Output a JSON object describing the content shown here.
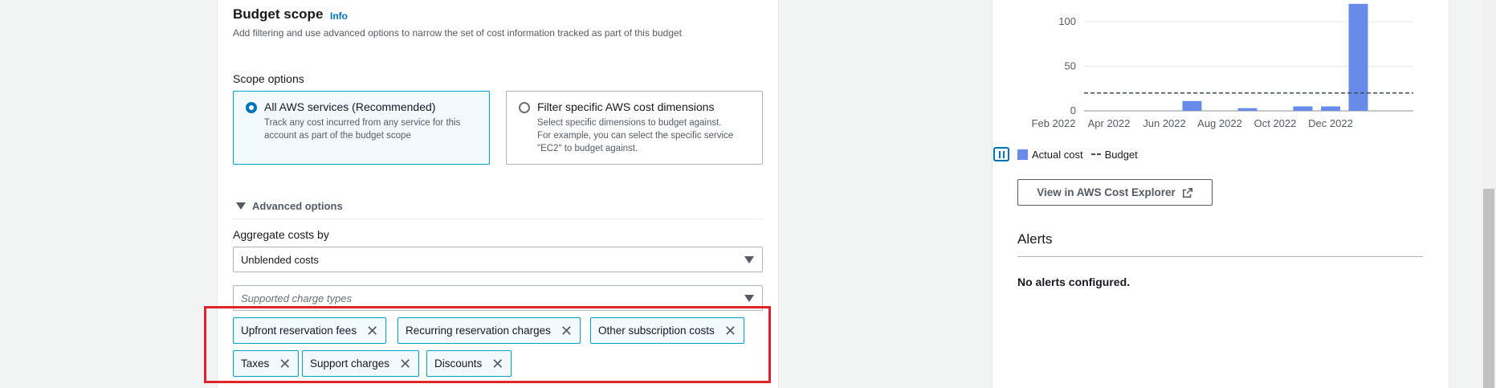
{
  "budget_scope": {
    "title": "Budget scope",
    "info_link": "Info",
    "description": "Add filtering and use advanced options to narrow the set of cost information tracked as part of this budget",
    "scope_options_label": "Scope options",
    "options": [
      {
        "title": "All AWS services (Recommended)",
        "description": "Track any cost incurred from any service for this\naccount as part of the budget scope",
        "selected": true
      },
      {
        "title": "Filter specific AWS cost dimensions",
        "description": "Select specific dimensions to budget against.\nFor example, you can select the specific service\n\"EC2\" to budget against.",
        "selected": false
      }
    ],
    "advanced_options_label": "Advanced options",
    "aggregate_label": "Aggregate costs by",
    "aggregate_value": "Unblended costs",
    "charge_types_placeholder": "Supported charge types",
    "tokens": [
      "Upfront reservation fees",
      "Recurring reservation charges",
      "Other subscription costs",
      "Taxes",
      "Support charges",
      "Discounts"
    ]
  },
  "chart_data": {
    "type": "bar",
    "y_ticks": [
      "100",
      "50",
      "0"
    ],
    "x_tick_labels": [
      "Feb 2022",
      "Apr 2022",
      "Jun 2022",
      "Aug 2022",
      "Oct 2022",
      "Dec 2022"
    ],
    "series": [
      {
        "name": "Actual cost",
        "x": [
          "Jul 2022",
          "Sep 2022",
          "Nov 2022",
          "Dec 2022",
          "Jan 2023"
        ],
        "values": [
          11,
          3,
          5,
          5,
          120
        ]
      },
      {
        "name": "Budget",
        "style": "dashed",
        "value": 20
      }
    ],
    "ylim": [
      0,
      100
    ],
    "colors": {
      "actual": "#688ae8",
      "budget": "#414d5c"
    }
  },
  "legend": {
    "actual_label": "Actual cost",
    "budget_label": "Budget"
  },
  "view_button": {
    "label": "View in AWS Cost Explorer"
  },
  "alerts": {
    "title": "Alerts",
    "empty_text": "No alerts configured."
  }
}
